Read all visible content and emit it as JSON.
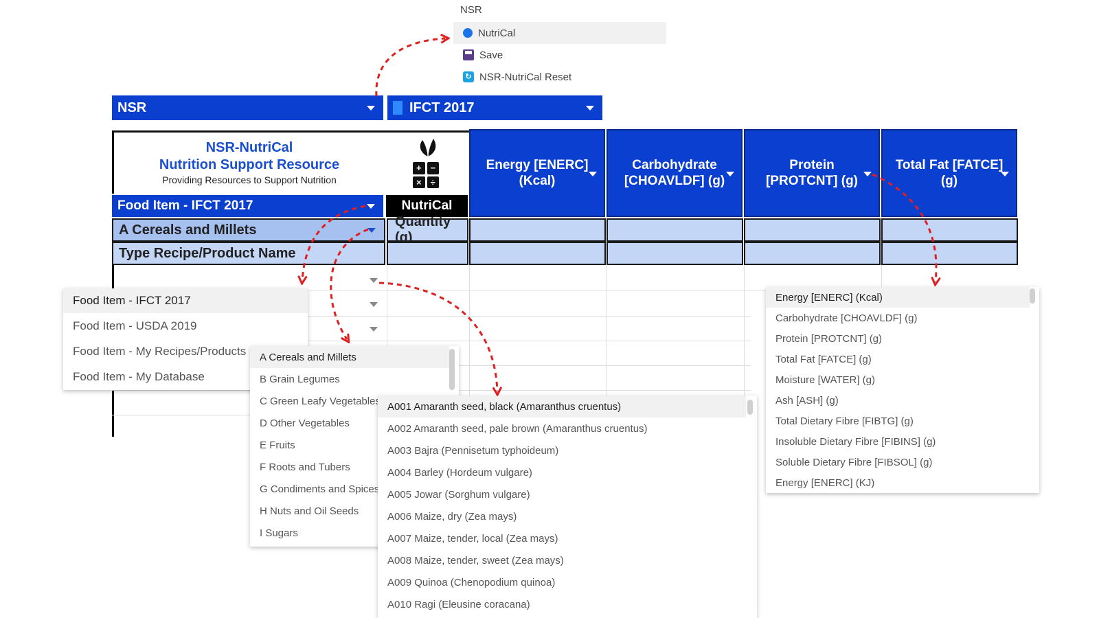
{
  "top_menu": {
    "title": "NSR",
    "items": [
      {
        "label": "NutriCal",
        "icon": "circle-icon"
      },
      {
        "label": "Save",
        "icon": "save-icon"
      },
      {
        "label": "NSR-NutriCal Reset",
        "icon": "reset-icon"
      }
    ]
  },
  "header_bar": {
    "left_label": "NSR",
    "right_label": "IFCT 2017"
  },
  "logo": {
    "title": "NSR-NutriCal",
    "subtitle": "Nutrition Support Resource",
    "tagline": "Providing Resources to Support Nutrition",
    "calc_glyphs": [
      "+",
      "−",
      "×",
      "÷"
    ]
  },
  "columns": [
    {
      "line1": "Energy [ENERC]",
      "line2": "(Kcal)"
    },
    {
      "line1": "Carbohydrate",
      "line2": "[CHOAVLDF] (g)"
    },
    {
      "line1": "Protein",
      "line2": "[PROTCNT] (g)"
    },
    {
      "line1": "Total Fat [FATCE]",
      "line2": "(g)"
    }
  ],
  "rows": {
    "source_select": "Food Item - IFCT 2017",
    "nutrical_label": "NutriCal",
    "category_select": "A Cereals and Millets",
    "quantity_label": "Quantity (g)",
    "name_input_placeholder": "Type Recipe/Product Name"
  },
  "source_dropdown": {
    "options": [
      "Food Item - IFCT 2017",
      "Food Item - USDA 2019",
      "Food Item - My Recipes/Products",
      "Food Item - My Database"
    ],
    "selected": 0
  },
  "category_dropdown": {
    "options": [
      "A Cereals and Millets",
      "B Grain Legumes",
      "C Green Leafy Vegetables",
      "D Other Vegetables",
      "E Fruits",
      "F Roots and Tubers",
      "G Condiments and Spices",
      "H Nuts and Oil Seeds",
      "I Sugars"
    ],
    "selected": 0
  },
  "food_dropdown": {
    "options": [
      "A001 Amaranth seed, black (Amaranthus cruentus)",
      "A002 Amaranth seed, pale brown (Amaranthus cruentus)",
      "A003 Bajra (Pennisetum typhoideum)",
      "A004 Barley (Hordeum vulgare)",
      "A005 Jowar (Sorghum vulgare)",
      "A006 Maize, dry (Zea mays)",
      "A007 Maize, tender, local (Zea mays)",
      "A008 Maize, tender, sweet (Zea mays)",
      "A009 Quinoa (Chenopodium quinoa)",
      "A010 Ragi (Eleusine coracana)"
    ],
    "selected": 0
  },
  "nutrient_dropdown": {
    "options": [
      "Energy [ENERC] (Kcal)",
      "Carbohydrate [CHOAVLDF] (g)",
      "Protein [PROTCNT] (g)",
      "Total Fat [FATCE] (g)",
      "Moisture [WATER] (g)",
      "Ash [ASH] (g)",
      "Total Dietary Fibre [FIBTG] (g)",
      "Insoluble Dietary Fibre [FIBINS] (g)",
      "Soluble Dietary Fibre [FIBSOL] (g)",
      "Energy [ENERC] (KJ)"
    ],
    "selected": 0
  },
  "colors": {
    "header_blue": "#0b3fcf",
    "title_blue": "#1a4fd0",
    "row_fill": "#c4d6f5",
    "arrow_red": "#e02020"
  }
}
